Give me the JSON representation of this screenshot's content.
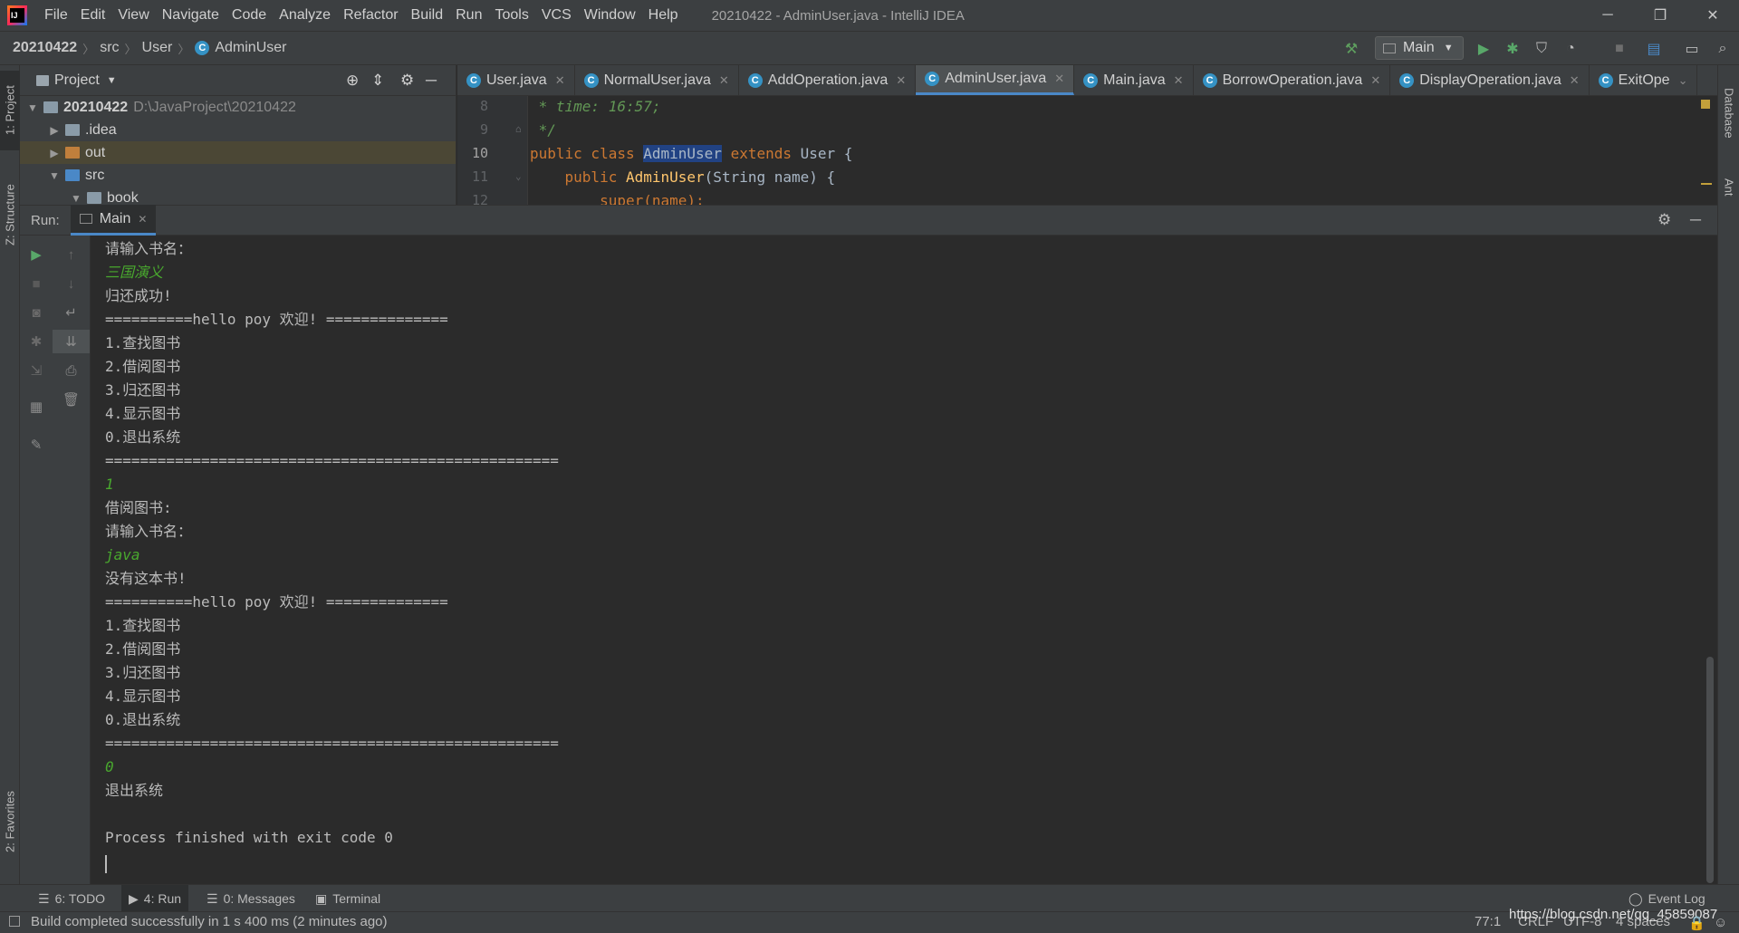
{
  "menu": [
    "File",
    "Edit",
    "View",
    "Navigate",
    "Code",
    "Analyze",
    "Refactor",
    "Build",
    "Run",
    "Tools",
    "VCS",
    "Window",
    "Help"
  ],
  "window_title": "20210422 - AdminUser.java - IntelliJ IDEA",
  "breadcrumb": {
    "project": "20210422",
    "folder1": "src",
    "folder2": "User",
    "file": "AdminUser"
  },
  "run_config": "Main",
  "side_tabs": {
    "project": "1: Project",
    "structure": "Z: Structure",
    "favorites": "2: Favorites",
    "database": "Database",
    "ant": "Ant"
  },
  "project_panel": {
    "title": "Project",
    "tree": [
      {
        "label": "20210422",
        "path": "D:\\JavaProject\\20210422"
      },
      {
        "label": ".idea"
      },
      {
        "label": "out"
      },
      {
        "label": "src"
      },
      {
        "label": "book"
      }
    ]
  },
  "editor_tabs": [
    "User.java",
    "NormalUser.java",
    "AddOperation.java",
    "AdminUser.java",
    "Main.java",
    "BorrowOperation.java",
    "DisplayOperation.java",
    "ExitOpe"
  ],
  "editor": {
    "line_numbers": [
      "8",
      "9",
      "10",
      "11",
      "12"
    ],
    "l8": " * time: 16:57;",
    "l9": " */",
    "l10_kw": "public class ",
    "l10_name": "AdminUser",
    "l10_ext": " extends",
    "l10_rest": " User {",
    "l11_kw": "    public ",
    "l11_fn": "AdminUser",
    "l11_rest": "(String name) {",
    "l12": "        super(name);"
  },
  "run_panel": {
    "label": "Run:",
    "tab": "Main"
  },
  "console": [
    "请输入书名：",
    "三国演义",
    "归还成功!",
    "==========hello poy 欢迎! ==============",
    "1.查找图书",
    "2.借阅图书",
    "3.归还图书",
    "4.显示图书",
    "0.退出系统",
    "====================================================",
    "1",
    "借阅图书:",
    "请输入书名：",
    "java",
    "没有这本书!",
    "==========hello poy 欢迎! ==============",
    "1.查找图书",
    "2.借阅图书",
    "3.归还图书",
    "4.显示图书",
    "0.退出系统",
    "====================================================",
    "0",
    "退出系统",
    "",
    "Process finished with exit code 0"
  ],
  "bottom_tabs": {
    "todo": "6: TODO",
    "run": "4: Run",
    "messages": "0: Messages",
    "terminal": "Terminal",
    "event_log": "Event Log"
  },
  "status": {
    "message": "Build completed successfully in 1 s 400 ms (2 minutes ago)",
    "position": "77:1",
    "line_sep": "CRLF",
    "encoding": "UTF-8",
    "indent": "4 spaces",
    "watermark": "https://blog.csdn.net/qq_45859087"
  }
}
